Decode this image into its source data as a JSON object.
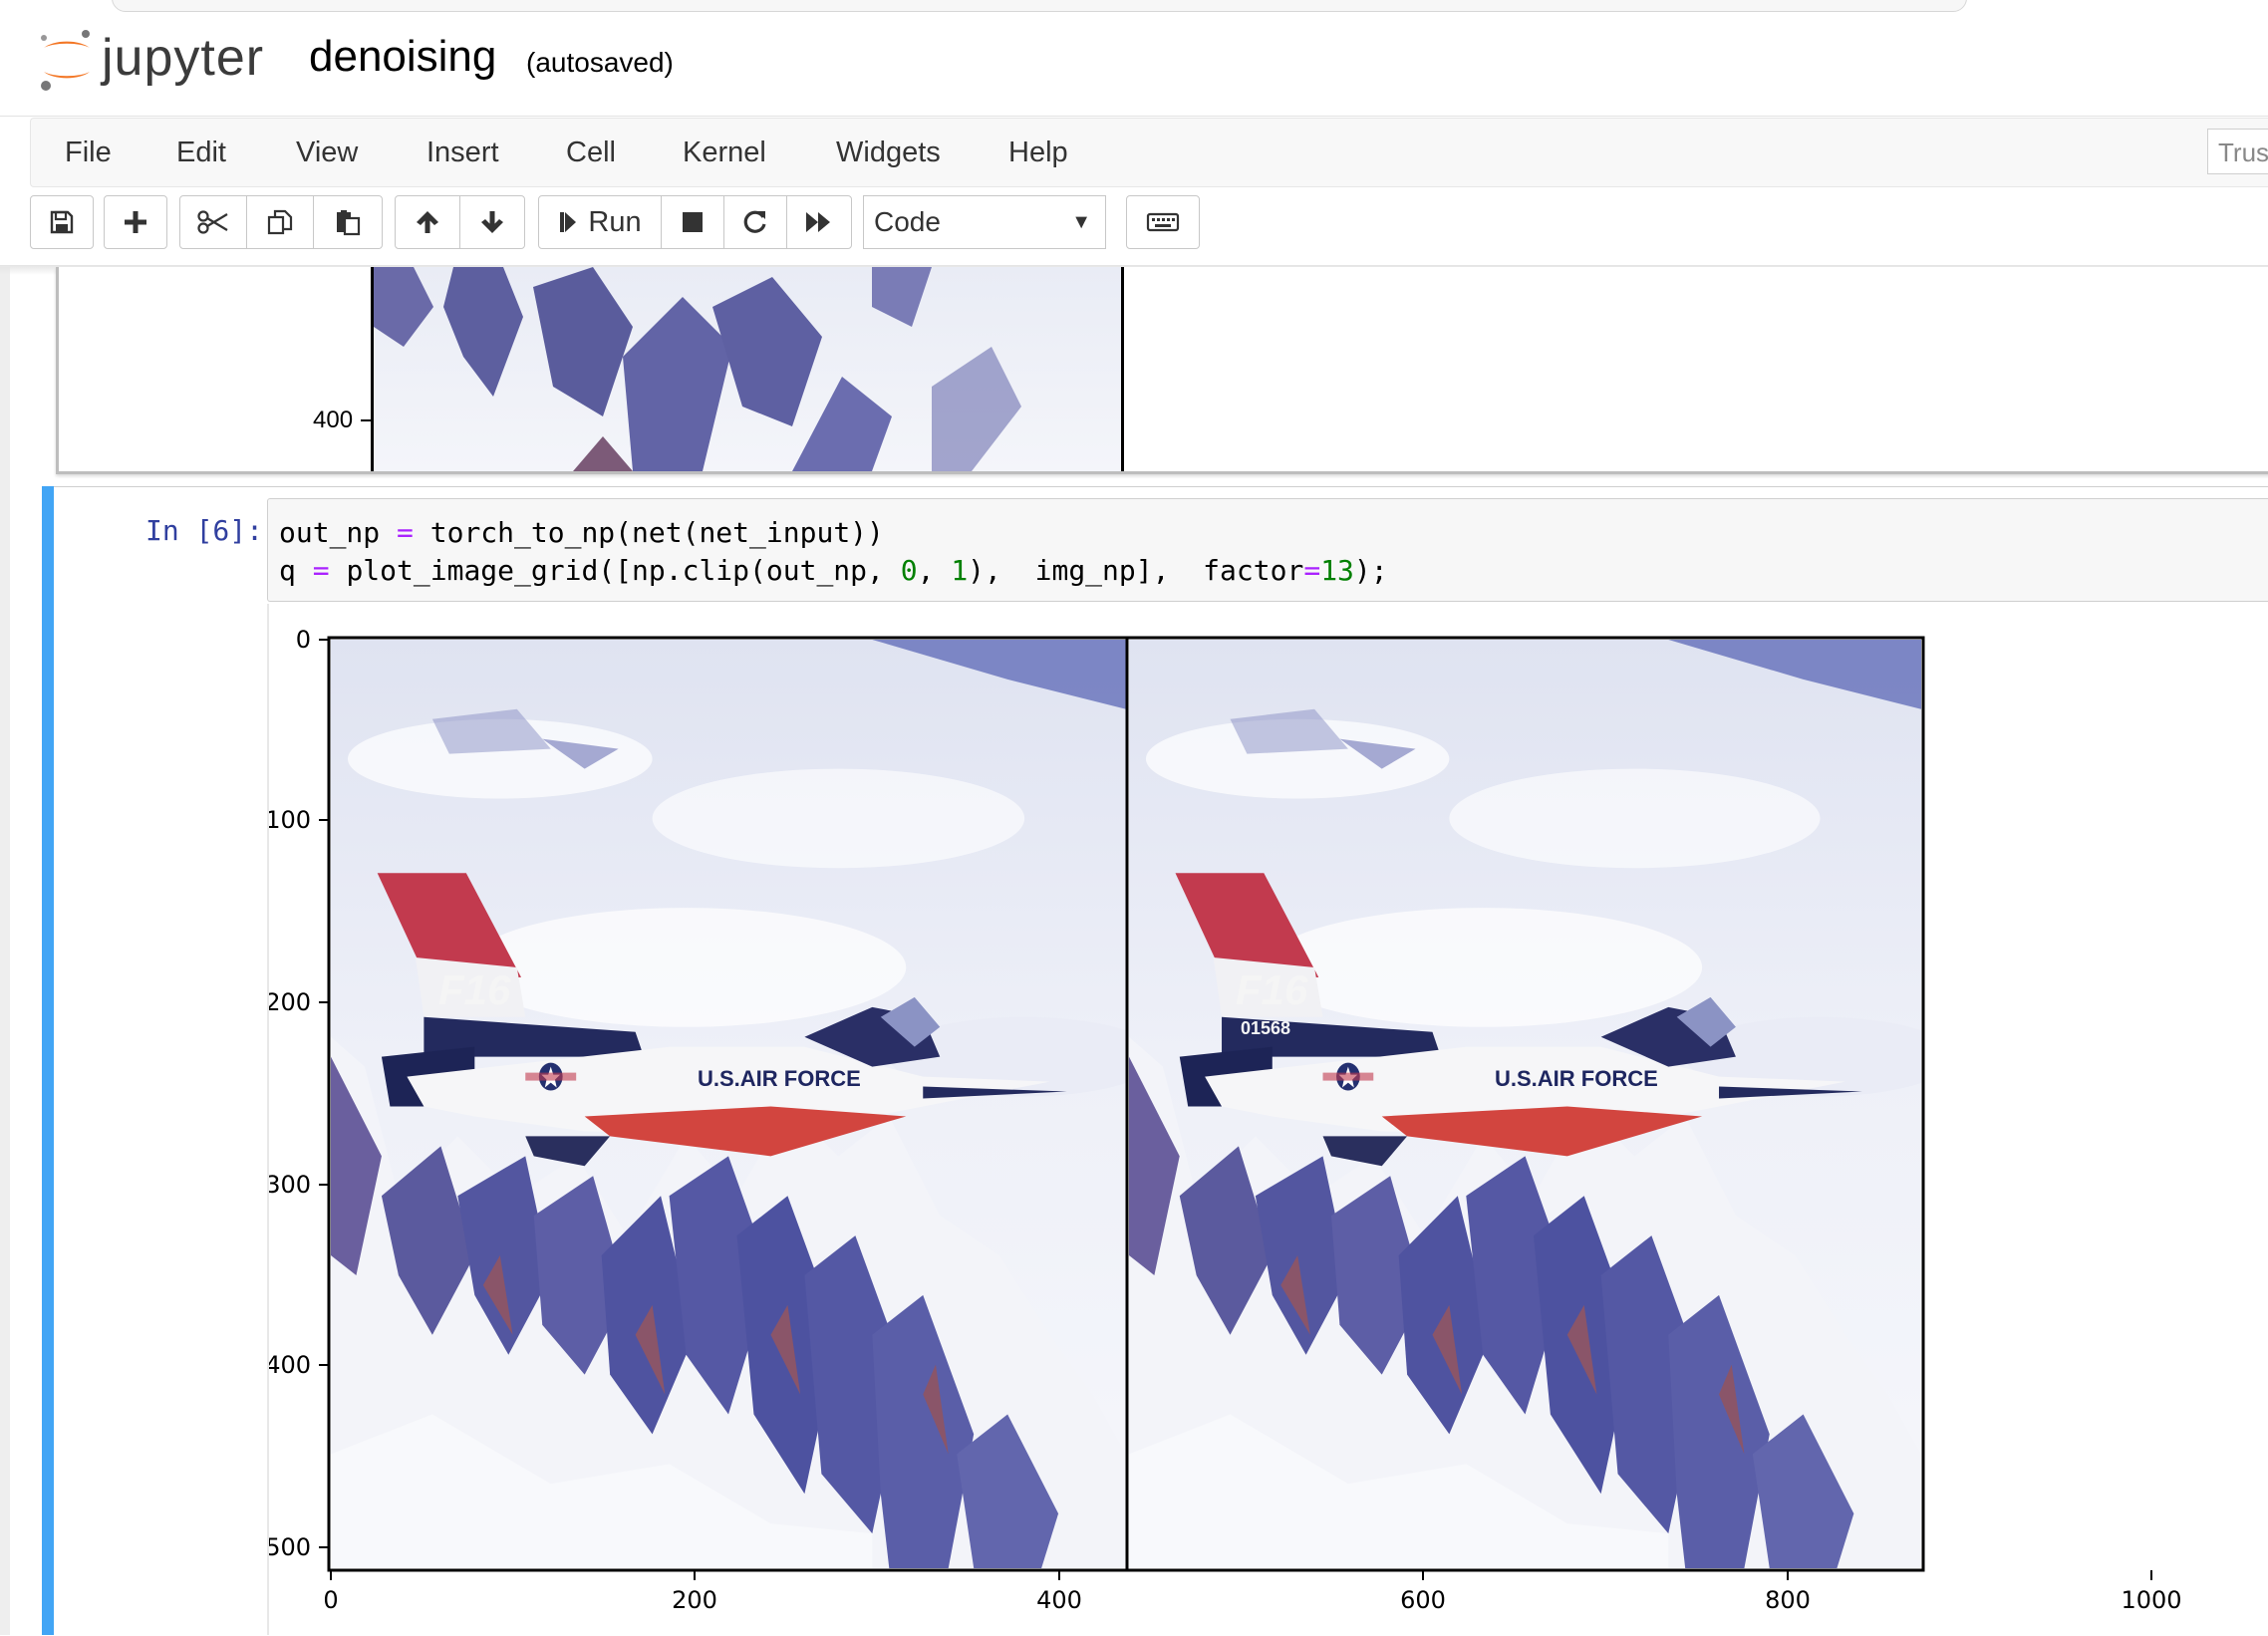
{
  "header": {
    "brand": "jupyter",
    "notebook_name": "denoising",
    "save_status": "(autosaved)"
  },
  "menu": {
    "items": [
      "File",
      "Edit",
      "View",
      "Insert",
      "Cell",
      "Kernel",
      "Widgets",
      "Help"
    ],
    "trusted_label": "Trus"
  },
  "toolbar": {
    "icons": [
      "save-icon",
      "plus-icon",
      "cut-icon",
      "copy-icon",
      "paste-icon",
      "arrow-up-icon",
      "arrow-down-icon",
      "step-forward-icon",
      "stop-icon",
      "restart-icon",
      "fast-forward-icon",
      "keyboard-icon"
    ],
    "run_label": "Run",
    "cell_type": "Code"
  },
  "previous_output": {
    "y_tick": "400"
  },
  "cell": {
    "prompt": "In [6]:",
    "code_line_1": {
      "a": "out_np",
      "eq": "=",
      "b": "torch_to_np(net(net_input))"
    },
    "code_line_2": {
      "a": "q",
      "eq": "=",
      "b": "plot_image_grid([np.clip(out_np,",
      "n0": "0",
      "c": ",",
      "n1": "1",
      "d": "),  img_np],  factor",
      "eq2": "=",
      "n13": "13",
      "e": ");"
    }
  },
  "output": {
    "x_ticks": [
      "0",
      "200",
      "400",
      "600",
      "800",
      "1000"
    ],
    "y_ticks": [
      "0",
      "100",
      "200",
      "300",
      "400",
      "500"
    ],
    "left_image_text": [
      "F16",
      "U.S.AIR FORCE"
    ],
    "right_image_text": [
      "F16",
      "01568",
      "U.S.AIR FORCE"
    ]
  }
}
